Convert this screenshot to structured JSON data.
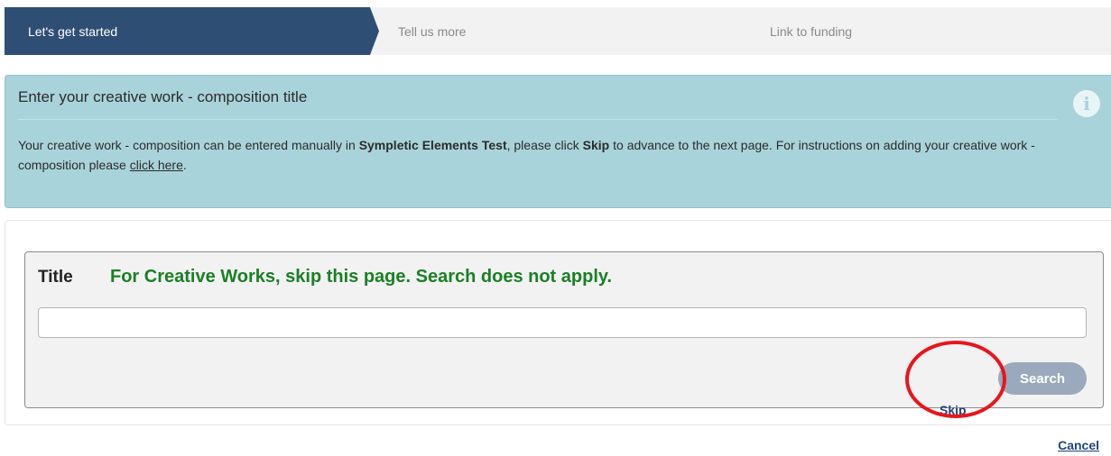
{
  "wizard": {
    "steps": [
      {
        "label": "Let's get started",
        "state": "active"
      },
      {
        "label": "Tell us more",
        "state": "inactive"
      },
      {
        "label": "Link to funding",
        "state": "inactive"
      }
    ]
  },
  "info_panel": {
    "title": "Enter your creative work - composition title",
    "text_1": "Your creative work - composition can be entered manually in ",
    "system_name": "Sympletic Elements Test",
    "text_2": ", please click ",
    "skip_word": "Skip",
    "text_3": " to advance to the next page. For instructions on adding your creative work - composition please ",
    "link_label": "click here",
    "text_4": ".",
    "icon": "info-icon"
  },
  "search": {
    "title_label": "Title",
    "note": "For Creative Works, skip this page. Search does not apply.",
    "input_value": "",
    "skip_label": "Skip",
    "search_label": "Search"
  },
  "footer": {
    "cancel_label": "Cancel"
  },
  "colors": {
    "active_step": "#2f4e74",
    "info_bg": "#a9d3da",
    "note_green": "#1b7f24",
    "annotation_red": "#e8161c",
    "search_button": "#9aa9bb"
  }
}
